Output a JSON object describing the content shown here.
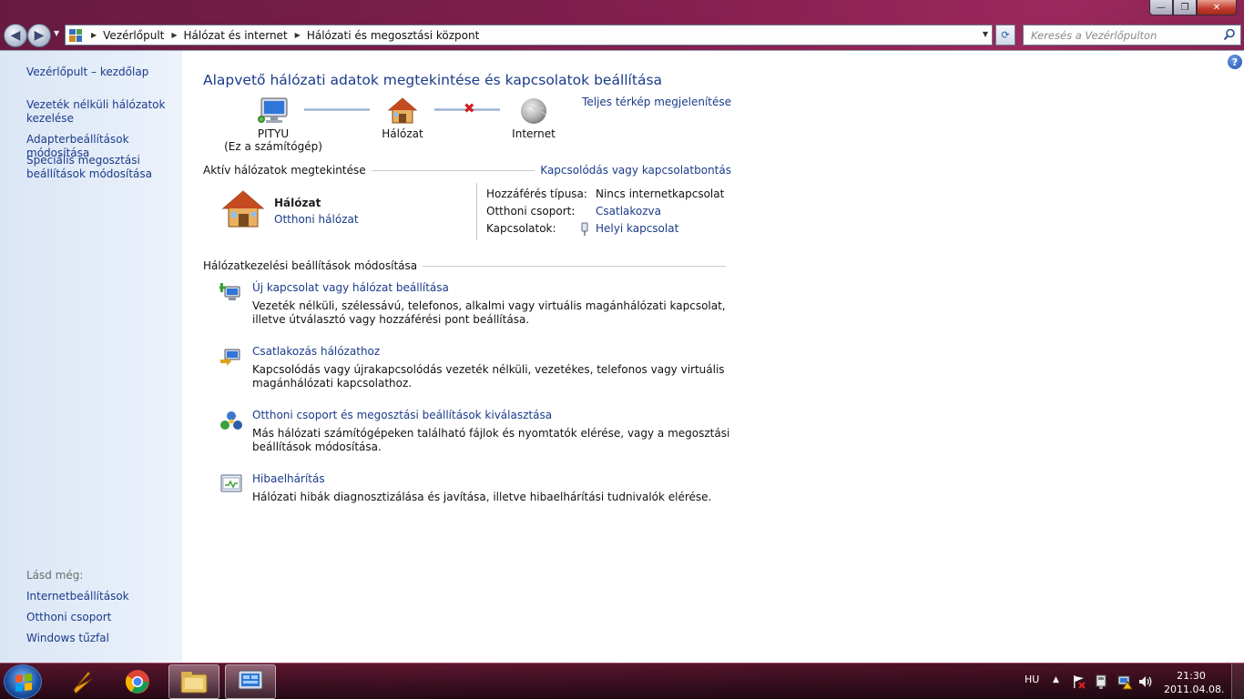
{
  "window": {
    "caption_buttons": {
      "minimize": "—",
      "maximize": "❐",
      "close": "✕"
    }
  },
  "navigation": {
    "back_glyph": "◀",
    "forward_glyph": "▶",
    "breadcrumb": [
      "Vezérlőpult",
      "Hálózat és internet",
      "Hálózati és megosztási központ"
    ],
    "breadcrumb_sep": "▶",
    "search_placeholder": "Keresés a Vezérlőpulton",
    "refresh_glyph": "⟳"
  },
  "sidebar": {
    "items": [
      {
        "label": "Vezérlőpult – kezdőlap"
      },
      {
        "label": "Vezeték nélküli hálózatok kezelése"
      },
      {
        "label": "Adapterbeállítások módosítása"
      },
      {
        "label": "Speciális megosztási beállítások módosítása"
      }
    ],
    "see_also_heading": "Lásd még:",
    "see_also": [
      {
        "label": "Internetbeállítások"
      },
      {
        "label": "Otthoni csoport"
      },
      {
        "label": "Windows tűzfal"
      }
    ]
  },
  "main": {
    "title": "Alapvető hálózati adatok megtekintése és kapcsolatok beállítása",
    "full_map_link": "Teljes térkép megjelenítése",
    "map": {
      "computer_name": "PITYU",
      "computer_sub": "(Ez a számítógép)",
      "network_name": "Hálózat",
      "internet_name": "Internet",
      "disconnected_mark": "✖"
    },
    "active_networks": {
      "heading": "Aktív hálózatok megtekintése",
      "connect_link": "Kapcsolódás vagy kapcsolatbontás",
      "network_name": "Hálózat",
      "network_type": "Otthoni hálózat",
      "access_type_label": "Hozzáférés típusa:",
      "access_type_value": "Nincs internetkapcsolat",
      "homegroup_label": "Otthoni csoport:",
      "homegroup_value": "Csatlakozva",
      "connections_label": "Kapcsolatok:",
      "connections_value": "Helyi kapcsolat"
    },
    "settings": {
      "heading": "Hálózatkezelési beállítások módosítása",
      "tasks": [
        {
          "title": "Új kapcsolat vagy hálózat beállítása",
          "desc": "Vezeték nélküli, szélessávú, telefonos, alkalmi vagy virtuális magánhálózati kapcsolat, illetve útválasztó vagy hozzáférési pont beállítása."
        },
        {
          "title": "Csatlakozás hálózathoz",
          "desc": "Kapcsolódás vagy újrakapcsolódás vezeték nélküli, vezetékes, telefonos vagy virtuális magánhálózati kapcsolathoz."
        },
        {
          "title": "Otthoni csoport és megosztási beállítások kiválasztása",
          "desc": "Más hálózati számítógépeken található fájlok és nyomtatók elérése, vagy a megosztási beállítások módosítása."
        },
        {
          "title": "Hibaelhárítás",
          "desc": "Hálózati hibák diagnosztizálása és javítása, illetve hibaelhárítási tudnivalók elérése."
        }
      ]
    }
  },
  "taskbar": {
    "language": "HU",
    "tray_arrow": "▲",
    "time": "21:30",
    "date": "2011.04.08."
  }
}
